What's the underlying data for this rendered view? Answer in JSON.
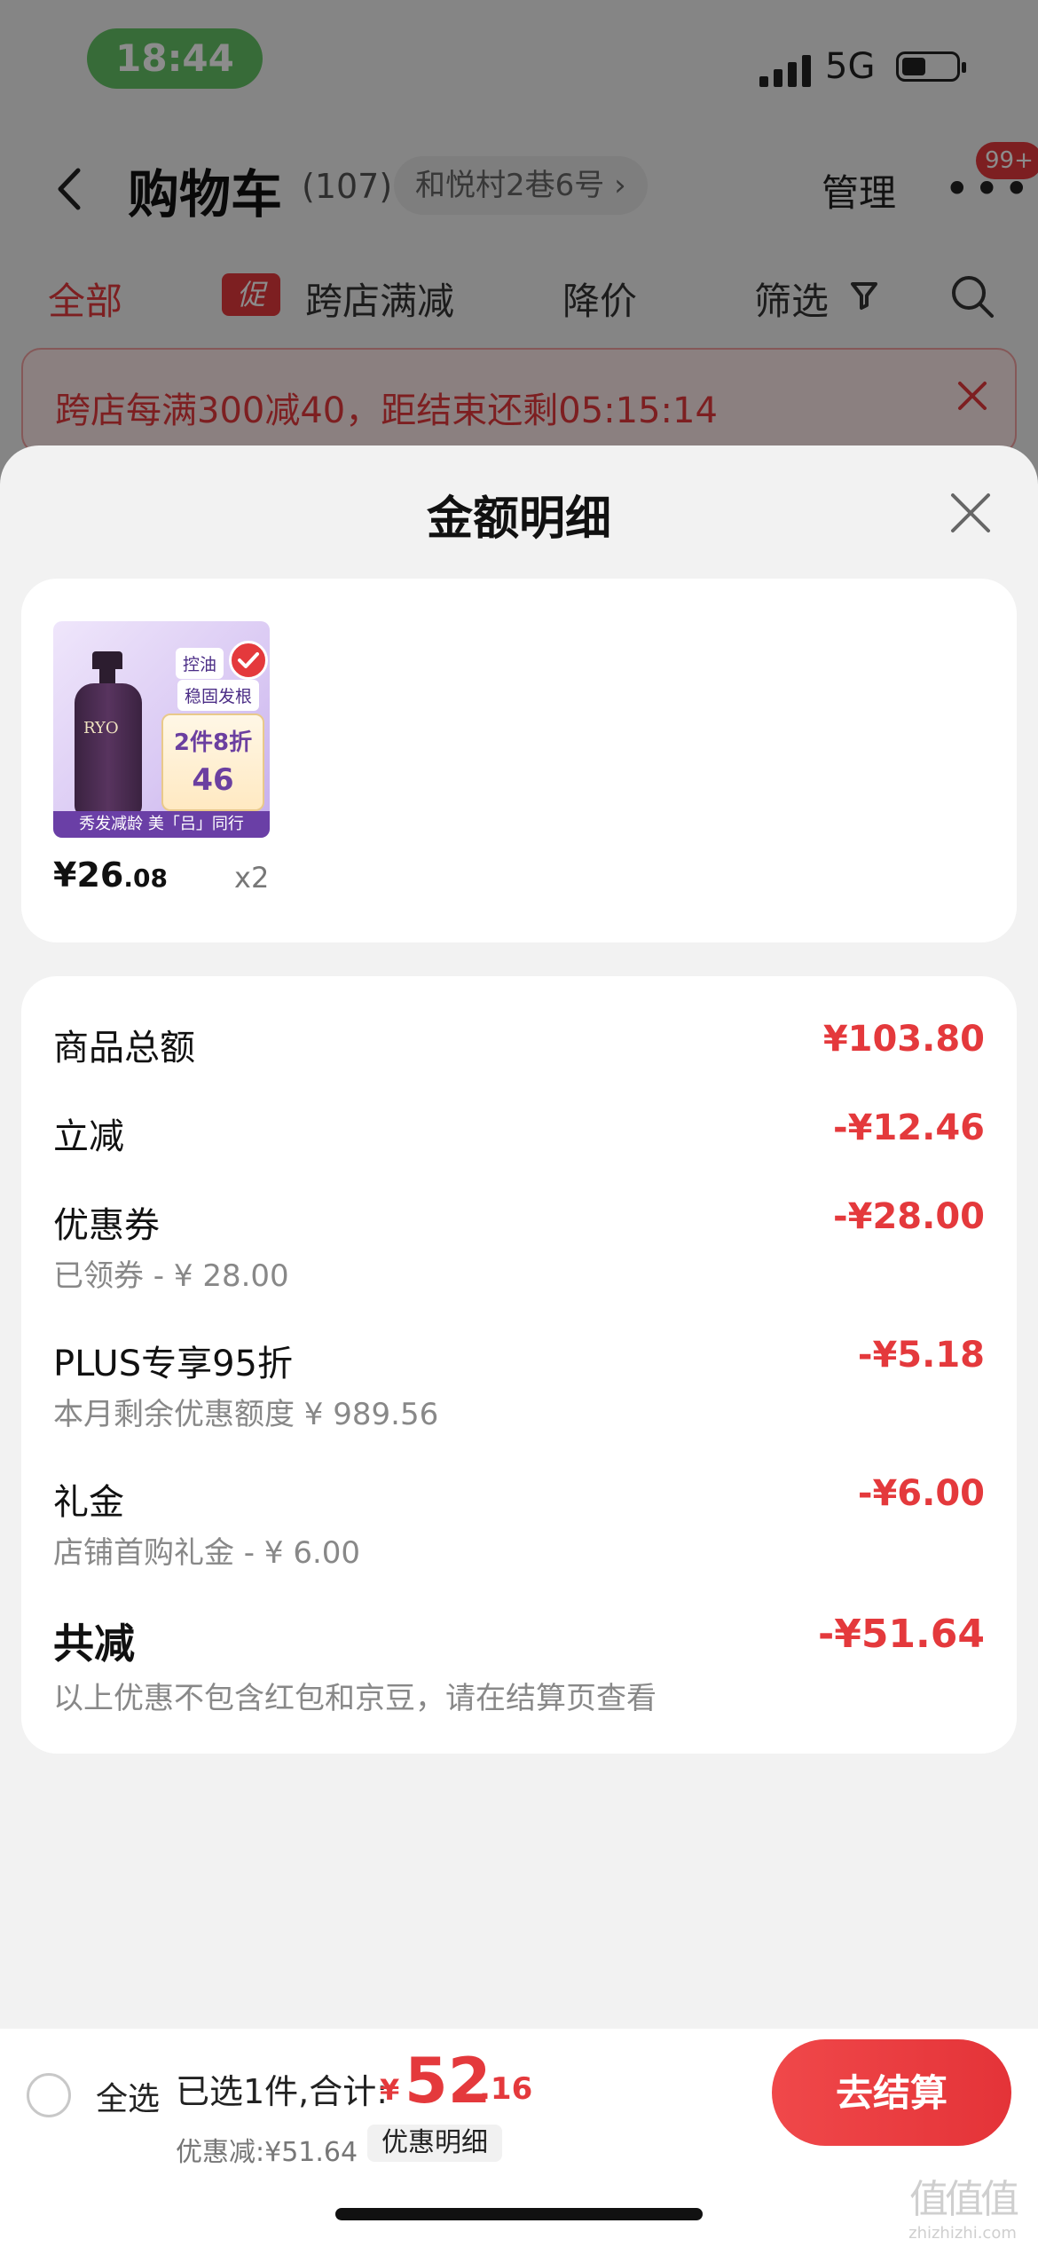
{
  "status_bar": {
    "time": "18:44",
    "network": "5G"
  },
  "header": {
    "title": "购物车",
    "count": "(107)",
    "address": "和悦村2巷6号 ›",
    "manage_label": "管理",
    "more_badge": "99+"
  },
  "tabs": [
    {
      "label": "全部"
    },
    {
      "label": "跨店满减",
      "badge": "促"
    },
    {
      "label": "降价"
    },
    {
      "label": "筛选"
    }
  ],
  "banner": {
    "text": "跨店每满300减40，距结束还剩05:15:14"
  },
  "sheet": {
    "title": "金额明细",
    "product": {
      "image_tags": [
        "控油",
        "稳固发根"
      ],
      "image_deal": [
        "2件8折",
        "46"
      ],
      "image_brand": "RYO",
      "image_caption": "秀发减龄 美「吕」同行",
      "price_int": "¥26",
      "price_dec": ".08",
      "quantity": "x2"
    },
    "details": {
      "subtotal": {
        "label": "商品总额",
        "value": "¥103.80"
      },
      "instant": {
        "label": "立减",
        "value": "-¥12.46"
      },
      "coupon": {
        "label": "优惠券",
        "value": "-¥28.00",
        "sub": "已领券 - ¥ 28.00"
      },
      "plus": {
        "label": "PLUS专享95折",
        "value": "-¥5.18",
        "sub": "本月剩余优惠额度 ¥ 989.56"
      },
      "gift": {
        "label": "礼金",
        "value": "-¥6.00",
        "sub": "店铺首购礼金 - ¥ 6.00"
      },
      "total": {
        "label": "共减",
        "value": "-¥51.64",
        "sub": "以上优惠不包含红包和京豆，请在结算页查看"
      }
    }
  },
  "bottom_bar": {
    "select_all": "全选",
    "selected": "已选1件,合计:",
    "currency": "¥",
    "total_int": "52",
    "total_dec": ".16",
    "saved": "优惠减:¥51.64",
    "discount_detail": "优惠明细",
    "checkout": "去结算"
  },
  "watermark": {
    "logo": "值值值",
    "text": "zhizhizhi.com"
  },
  "colors": {
    "accent": "#e4393c",
    "status_pill": "#65c466"
  },
  "icons": [
    "back-icon",
    "more-icon",
    "filter-icon",
    "search-icon",
    "close-icon",
    "check-icon"
  ]
}
